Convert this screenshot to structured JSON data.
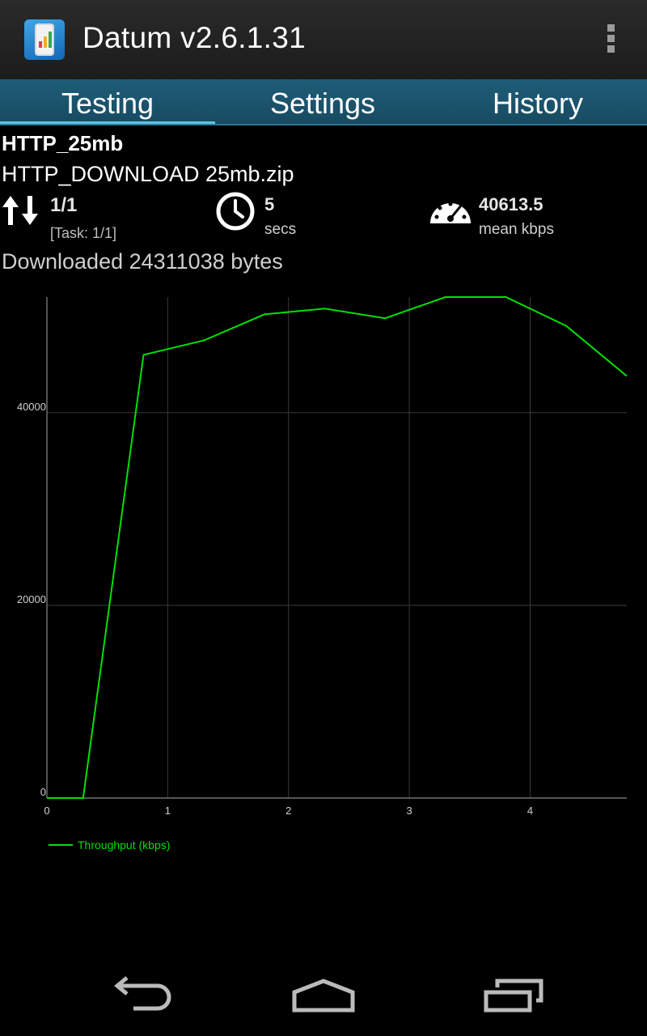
{
  "app": {
    "title": "Datum v2.6.1.31",
    "icon": "app-phone-icon"
  },
  "tabs": [
    {
      "label": "Testing",
      "active": true
    },
    {
      "label": "Settings",
      "active": false
    },
    {
      "label": "History",
      "active": false
    }
  ],
  "test": {
    "name": "HTTP_25mb",
    "file": "HTTP_DOWNLOAD 25mb.zip",
    "count": "1/1",
    "task": "[Task: 1/1]",
    "duration_value": "5",
    "duration_unit": "secs",
    "mean_value": "40613.5",
    "mean_unit": "mean kbps",
    "downloaded": "Downloaded 24311038 bytes"
  },
  "colors": {
    "series": "#00e000",
    "tab_bg": "#1a5068",
    "tab_indicator": "#5fc4e6"
  },
  "chart_data": {
    "type": "line",
    "title": "",
    "xlabel": "",
    "ylabel": "",
    "xlim": [
      0,
      4.8
    ],
    "ylim": [
      0,
      52000
    ],
    "x_ticks": [
      0,
      1,
      2,
      3,
      4
    ],
    "y_ticks": [
      0,
      20000,
      40000
    ],
    "grid": true,
    "legend": "bottom-left",
    "series": [
      {
        "name": "Throughput (kbps)",
        "x": [
          0,
          0.3,
          0.8,
          1.3,
          1.8,
          2.3,
          2.8,
          3.3,
          3.8,
          4.3,
          4.8
        ],
        "y": [
          0,
          0,
          46000,
          47500,
          50200,
          50800,
          49800,
          52000,
          52000,
          49000,
          43800
        ]
      }
    ]
  },
  "navbar": {
    "back": "back-icon",
    "home": "home-icon",
    "recents": "recents-icon"
  }
}
